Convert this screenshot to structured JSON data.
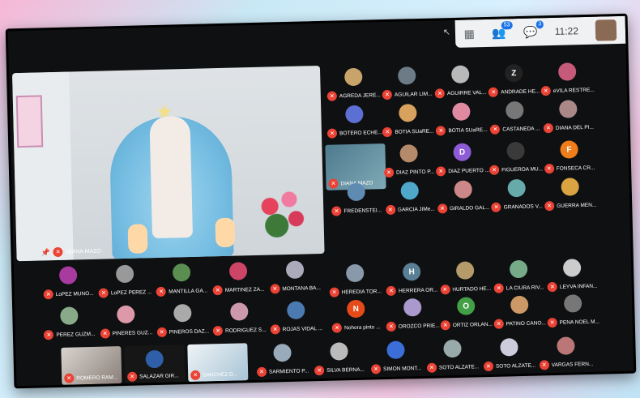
{
  "topbar": {
    "people_count": "53",
    "chat_count": "3",
    "time": "11:22"
  },
  "main_speaker": {
    "name": "DIANA MAZO"
  },
  "small_video": {
    "name": "DIANA MAZO"
  },
  "video_tiles": [
    {
      "name": "ROMERO RAM..."
    },
    {
      "name": "SALAZAR GIR..."
    },
    {
      "name": "SANCHEZ D..."
    }
  ],
  "participants": [
    {
      "name": "AGREDA JERE...",
      "avatar": "",
      "color": "#c9a46a"
    },
    {
      "name": "AGUILAR LIM...",
      "avatar": "",
      "color": "#6d7b86"
    },
    {
      "name": "AGUIRRE VAL...",
      "avatar": "",
      "color": "#b9b9b9"
    },
    {
      "name": "ANDRADE HE...",
      "avatar": "Z",
      "color": "#222"
    },
    {
      "name": "eVILA RESTRE...",
      "avatar": "",
      "color": "#c65a7a"
    },
    {
      "name": "BOTERO ECHE...",
      "avatar": "",
      "color": "#5c6fd3"
    },
    {
      "name": "BOTIA SUaRE...",
      "avatar": "",
      "color": "#d8a15d"
    },
    {
      "name": "BOTIA SUaRE...",
      "avatar": "",
      "color": "#e08aa2"
    },
    {
      "name": "CASTANEDA ...",
      "avatar": "",
      "color": "#777"
    },
    {
      "name": "DIANA DEL PI...",
      "avatar": "",
      "color": "#a88"
    },
    {
      "name": "DIAZ PINTO P...",
      "avatar": "",
      "color": "#b48a6a"
    },
    {
      "name": "DIAZ PUERTO ...",
      "avatar": "D",
      "color": "#8e5bd6"
    },
    {
      "name": "FIGUEROA MU...",
      "avatar": "",
      "color": "#3a3a3a"
    },
    {
      "name": "FONSECA CR...",
      "avatar": "F",
      "color": "#ef7d1a"
    },
    {
      "name": "FREDENSTEI...",
      "avatar": "",
      "color": "#5f8bb2"
    },
    {
      "name": "GARCIA JIMe...",
      "avatar": "",
      "color": "#4fa7c9"
    },
    {
      "name": "GIRALDO GAL...",
      "avatar": "",
      "color": "#c88"
    },
    {
      "name": "GRANADOS V...",
      "avatar": "",
      "color": "#6aa"
    },
    {
      "name": "GUERRA MEN...",
      "avatar": "",
      "color": "#d9a441"
    },
    {
      "name": "LoPEZ MUNO...",
      "avatar": "",
      "color": "#a83aa0"
    },
    {
      "name": "LoPEZ PEREZ ...",
      "avatar": "",
      "color": "#999"
    },
    {
      "name": "MANTILLA GA...",
      "avatar": "",
      "color": "#5b8f52"
    },
    {
      "name": "MARTINEZ ZA...",
      "avatar": "",
      "color": "#c46"
    },
    {
      "name": "MONTANA BA...",
      "avatar": "",
      "color": "#aab"
    },
    {
      "name": "HEREDIA TOR...",
      "avatar": "",
      "color": "#8899aa"
    },
    {
      "name": "HERRERA OR...",
      "avatar": "H",
      "color": "#5a7f95"
    },
    {
      "name": "HURTADO HE...",
      "avatar": "",
      "color": "#b59a6a"
    },
    {
      "name": "LA CIURA RIV...",
      "avatar": "",
      "color": "#7a8"
    },
    {
      "name": "LEYVA INFAN...",
      "avatar": "",
      "color": "#ccc"
    },
    {
      "name": "PEREZ GUZM...",
      "avatar": "",
      "color": "#8a8"
    },
    {
      "name": "PINERES GUZ...",
      "avatar": "",
      "color": "#d9a"
    },
    {
      "name": "PINEROS DAZ...",
      "avatar": "",
      "color": "#aaa"
    },
    {
      "name": "RODRIGUEZ S...",
      "avatar": "",
      "color": "#c9a"
    },
    {
      "name": "ROJAS VIDAL ...",
      "avatar": "",
      "color": "#4a7ab0"
    },
    {
      "name": "Nohora pinto ...",
      "avatar": "N",
      "color": "#e64a19"
    },
    {
      "name": "OROZCO PRIE...",
      "avatar": "",
      "color": "#a9c"
    },
    {
      "name": "ORTIZ ORLAN...",
      "avatar": "O",
      "color": "#43a047"
    },
    {
      "name": "PATINO CANO...",
      "avatar": "",
      "color": "#c96"
    },
    {
      "name": "PENA NOEL M...",
      "avatar": "",
      "color": "#777"
    },
    {
      "name": "SARMIENTO P...",
      "avatar": "",
      "color": "#9ab"
    },
    {
      "name": "SILVA BERNA...",
      "avatar": "",
      "color": "#bbb"
    },
    {
      "name": "SIMON MONT...",
      "avatar": "",
      "color": "#3b6ed8"
    },
    {
      "name": "SOTO ALZATE...",
      "avatar": "",
      "color": "#9aa"
    },
    {
      "name": "SOTO ALZATE...",
      "avatar": "",
      "color": "#ccd"
    },
    {
      "name": "VARGAS FERN...",
      "avatar": "",
      "color": "#b77"
    }
  ]
}
